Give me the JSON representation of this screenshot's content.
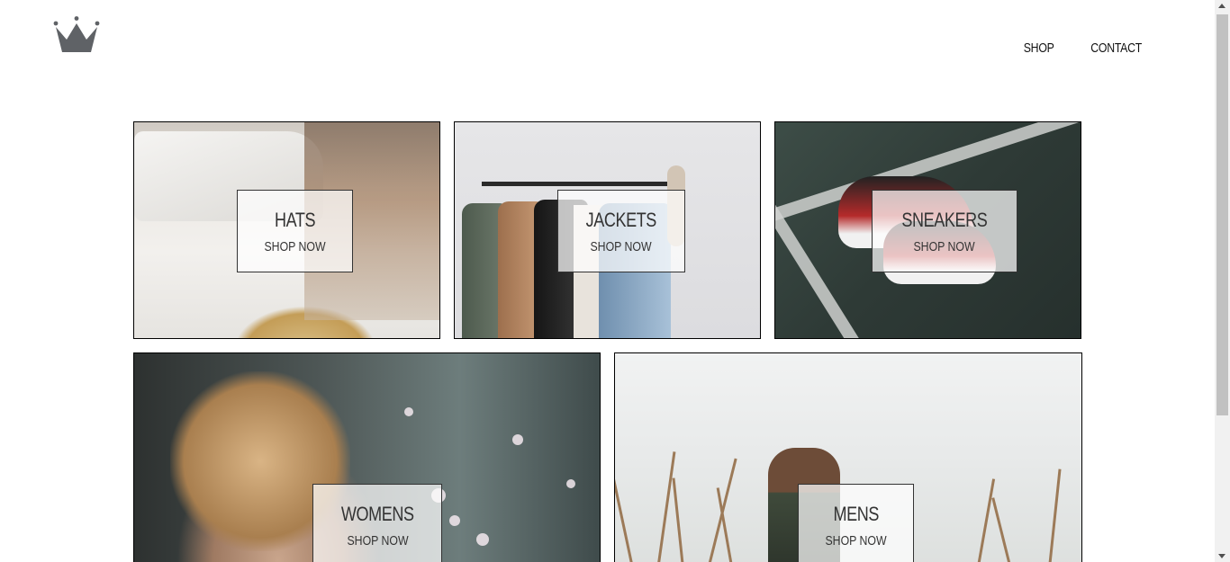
{
  "header": {
    "logo_icon": "crown-icon",
    "nav": {
      "shop": "SHOP",
      "contact": "CONTACT"
    }
  },
  "directory": {
    "items": [
      {
        "title": "HATS",
        "cta": "SHOP NOW"
      },
      {
        "title": "JACKETS",
        "cta": "SHOP NOW"
      },
      {
        "title": "SNEAKERS",
        "cta": "SHOP NOW"
      },
      {
        "title": "WOMENS",
        "cta": "SHOP NOW"
      },
      {
        "title": "MENS",
        "cta": "SHOP NOW"
      }
    ]
  },
  "colors": {
    "text": "#111111",
    "border": "#000000",
    "logo": "#5f6266"
  }
}
